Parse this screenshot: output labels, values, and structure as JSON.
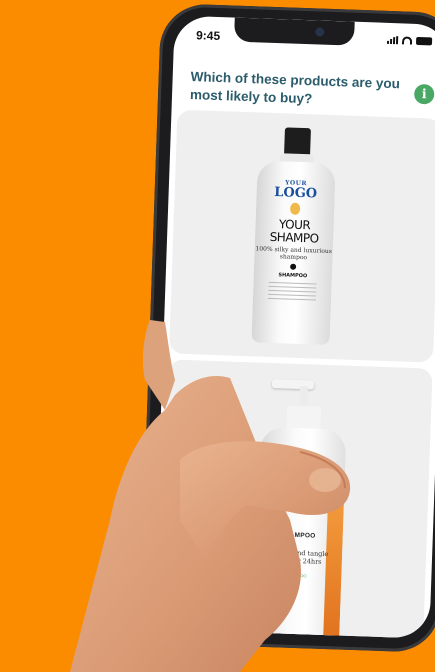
{
  "status_bar": {
    "time": "9:45"
  },
  "survey": {
    "question": "Which of these products are you most likely to buy?"
  },
  "info_button": {
    "glyph": "i",
    "icon": "info-icon"
  },
  "options": [
    {
      "label_your": "YOUR",
      "label_logo": "LOGO",
      "label_heading_1": "YOUR",
      "label_heading_2": "SHAMPO",
      "label_sub": "100% silky and luxurious shampoo",
      "label_small": "SHAMPOO"
    },
    {
      "label_shampoo": "SHAMPOO",
      "label_desc": "Smooth and tangle free hair 24hrs",
      "label_small": "SHAMPOO"
    }
  ],
  "colors": {
    "background": "#fb8c00",
    "question_text": "#2b5c6b",
    "info_button": "#48a864",
    "logo_blue": "#1a4f9e",
    "stripe_orange": "#f39b3c",
    "stripe_green": "#8ccf3f"
  }
}
